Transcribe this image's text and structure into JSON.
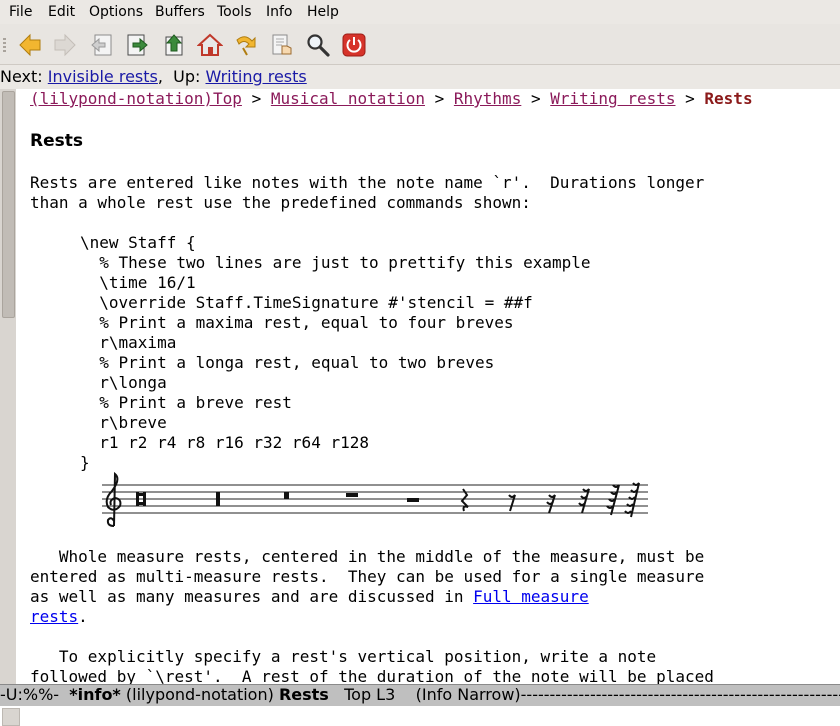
{
  "menubar": {
    "items": [
      {
        "label": "File"
      },
      {
        "label": "Edit"
      },
      {
        "label": "Options"
      },
      {
        "label": "Buffers"
      },
      {
        "label": "Tools"
      },
      {
        "label": "Info"
      },
      {
        "label": "Help"
      }
    ]
  },
  "toolbar": {
    "buttons": [
      {
        "icon": "arrow-left-icon"
      },
      {
        "icon": "arrow-right-icon"
      },
      {
        "icon": "prev-node-icon"
      },
      {
        "icon": "next-node-icon"
      },
      {
        "icon": "up-node-icon"
      },
      {
        "icon": "home-icon"
      },
      {
        "icon": "history-icon"
      },
      {
        "icon": "index-icon"
      },
      {
        "icon": "search-icon"
      },
      {
        "icon": "quit-icon"
      }
    ]
  },
  "header": {
    "next_label": "Next:",
    "next_link": "Invisible rests",
    "up_label": "Up:",
    "up_link": "Writing rests"
  },
  "breadcrumb": {
    "top": "(lilypond-notation)Top",
    "sep": ">",
    "musical_notation": "Musical notation",
    "rhythms": "Rhythms",
    "writing_rests": "Writing rests",
    "current": "Rests"
  },
  "content": {
    "heading": "Rests",
    "para1_line1": "Rests are entered like notes with the note name `r'.  Durations longer",
    "para1_line2": "than a whole rest use the predefined commands shown:",
    "code": [
      "\\new Staff {",
      "  % These two lines are just to prettify this example",
      "  \\time 16/1",
      "  \\override Staff.TimeSignature #'stencil = ##f",
      "  % Print a maxima rest, equal to four breves",
      "  r\\maxima",
      "  % Print a longa rest, equal to two breves",
      "  r\\longa",
      "  % Print a breve rest",
      "  r\\breve",
      "  r1 r2 r4 r8 r16 r32 r64 r128",
      "}"
    ],
    "para2_line1": "   Whole measure rests, centered in the middle of the measure, must be",
    "para2_line2": "entered as multi-measure rests.  They can be used for a single measure",
    "para2_line3_pre": "as well as many measures and are discussed in ",
    "para2_link_a": "Full measure",
    "para2_link_b": "rests",
    "para2_end": ".",
    "para3_line1": "   To explicitly specify a rest's vertical position, write a note",
    "para3_line2": "followed by `\\rest'.  A rest of the duration of the note will be placed"
  },
  "modeline": {
    "status": "-U:%%-",
    "buffer": "*info*",
    "file": "(lilypond-notation)",
    "node": "Rests",
    "position": "Top L3",
    "mode": "(Info Narrow)",
    "fill": "----------------------------------------------------------------"
  },
  "colors": {
    "menubar_bg": "#ebe8e4",
    "modeline_bg": "#bfbfbf",
    "xref": "#8b1a5a",
    "link": "#0000ee"
  }
}
